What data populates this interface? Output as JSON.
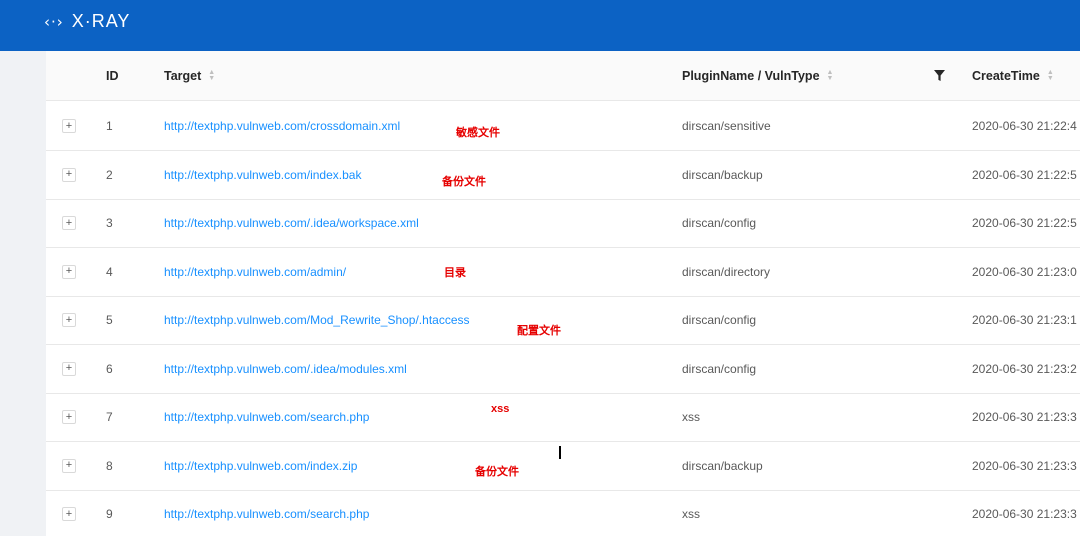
{
  "app": {
    "logo_text": "X·RAY",
    "logo_icon": "code-brackets-icon"
  },
  "table": {
    "columns": {
      "id": "ID",
      "target": "Target",
      "plugin": "PluginName / VulnType",
      "time": "CreateTime"
    },
    "expand_symbol": "+",
    "rows": [
      {
        "id": "1",
        "target": "http://textphp.vulnweb.com/crossdomain.xml",
        "plugin": "dirscan/sensitive",
        "time": "2020-06-30 21:22:4"
      },
      {
        "id": "2",
        "target": "http://textphp.vulnweb.com/index.bak",
        "plugin": "dirscan/backup",
        "time": "2020-06-30 21:22:5"
      },
      {
        "id": "3",
        "target": "http://textphp.vulnweb.com/.idea/workspace.xml",
        "plugin": "dirscan/config",
        "time": "2020-06-30 21:22:5"
      },
      {
        "id": "4",
        "target": "http://textphp.vulnweb.com/admin/",
        "plugin": "dirscan/directory",
        "time": "2020-06-30 21:23:0"
      },
      {
        "id": "5",
        "target": "http://textphp.vulnweb.com/Mod_Rewrite_Shop/.htaccess",
        "plugin": "dirscan/config",
        "time": "2020-06-30 21:23:1"
      },
      {
        "id": "6",
        "target": "http://textphp.vulnweb.com/.idea/modules.xml",
        "plugin": "dirscan/config",
        "time": "2020-06-30 21:23:2"
      },
      {
        "id": "7",
        "target": "http://textphp.vulnweb.com/search.php",
        "plugin": "xss",
        "time": "2020-06-30 21:23:3"
      },
      {
        "id": "8",
        "target": "http://textphp.vulnweb.com/index.zip",
        "plugin": "dirscan/backup",
        "time": "2020-06-30 21:23:3"
      },
      {
        "id": "9",
        "target": "http://textphp.vulnweb.com/search.php",
        "plugin": "xss",
        "time": "2020-06-30 21:23:3"
      }
    ]
  },
  "annotations": [
    "敏感文件",
    "备份文件",
    "目录",
    "配置文件",
    "xss",
    "备份文件"
  ],
  "colors": {
    "header_bar": "#0c62c4",
    "link": "#1890ff",
    "annotation": "#e60000"
  }
}
